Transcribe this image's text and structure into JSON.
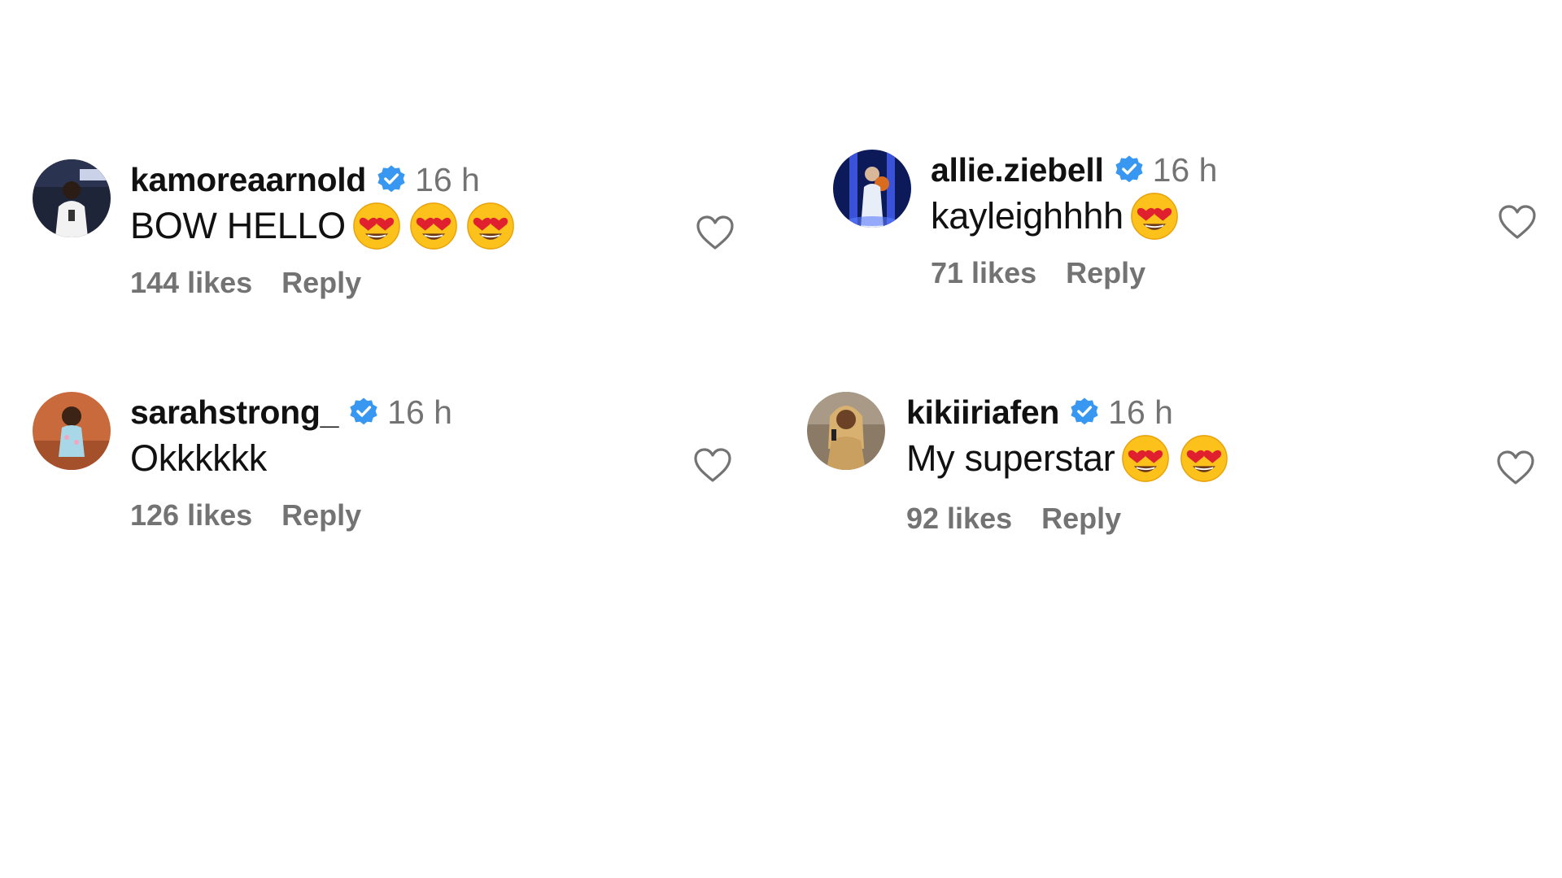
{
  "comments": [
    {
      "username": "kamoreaarnold",
      "time": "16 h",
      "text": "BOW HELLO",
      "emoji_count": 3,
      "emoji": "heart-eyes-emoji",
      "likes": "144 likes",
      "reply": "Reply"
    },
    {
      "username": "allie.ziebell",
      "time": "16 h",
      "text": "kayleighhhh",
      "emoji_count": 1,
      "emoji": "heart-eyes-emoji",
      "likes": "71 likes",
      "reply": "Reply"
    },
    {
      "username": "sarahstrong_",
      "time": "16 h",
      "text": "Okkkkkk",
      "emoji_count": 0,
      "likes": "126 likes",
      "reply": "Reply"
    },
    {
      "username": "kikiiriafen",
      "time": "16 h",
      "text": "My superstar",
      "emoji_count": 2,
      "emoji": "heart-eyes-emoji",
      "likes": "92 likes",
      "reply": "Reply"
    }
  ],
  "colors": {
    "verified_badge": "#3897f0",
    "secondary_text": "#737373",
    "primary_text": "#111111"
  },
  "icons": {
    "verified": "verified-badge-icon",
    "like": "heart-outline-icon"
  }
}
